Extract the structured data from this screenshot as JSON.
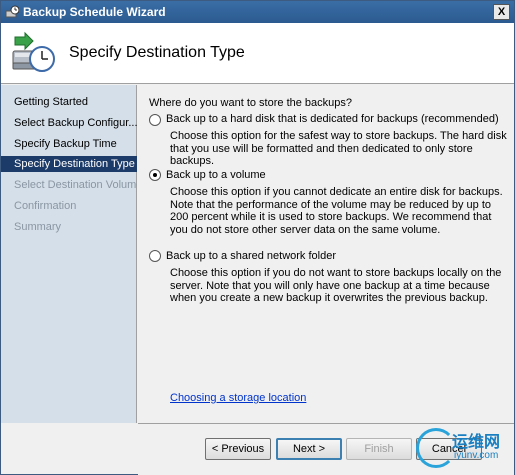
{
  "window": {
    "title": "Backup Schedule Wizard",
    "close_label": "X"
  },
  "header": {
    "title": "Specify Destination Type",
    "icon": "backup-clock-icon"
  },
  "sidebar": {
    "steps": [
      {
        "label": "Getting Started",
        "state": "normal"
      },
      {
        "label": "Select Backup Configur...",
        "state": "normal"
      },
      {
        "label": "Specify Backup Time",
        "state": "normal"
      },
      {
        "label": "Specify Destination Type",
        "state": "active"
      },
      {
        "label": "Select Destination Volume",
        "state": "disabled"
      },
      {
        "label": "Confirmation",
        "state": "disabled"
      },
      {
        "label": "Summary",
        "state": "disabled"
      }
    ]
  },
  "content": {
    "question": "Where do you want to store the backups?",
    "options": [
      {
        "label": "Back up to a hard disk that is dedicated for backups (recommended)",
        "description": "Choose this option for the safest way to store backups. The hard disk that you use will be formatted and then dedicated to only store backups.",
        "selected": false
      },
      {
        "label": "Back up to a volume",
        "description": "Choose this option if you cannot dedicate an entire disk for backups. Note that the performance of the volume may be reduced by up to 200 percent while it is used to store backups. We recommend that you do not store other server data on the same volume.",
        "selected": true
      },
      {
        "label": "Back up to a shared network folder",
        "description": "Choose this option if you do not want to store backups locally on the server. Note that you will only have one backup at a time because when you create a new backup it overwrites the previous backup.",
        "selected": false
      }
    ],
    "link": "Choosing a storage location"
  },
  "footer": {
    "previous": "< Previous",
    "next": "Next >",
    "finish": "Finish",
    "cancel": "Cancel"
  },
  "watermark": {
    "brand": "运维网",
    "domain": "iyunv.com"
  }
}
